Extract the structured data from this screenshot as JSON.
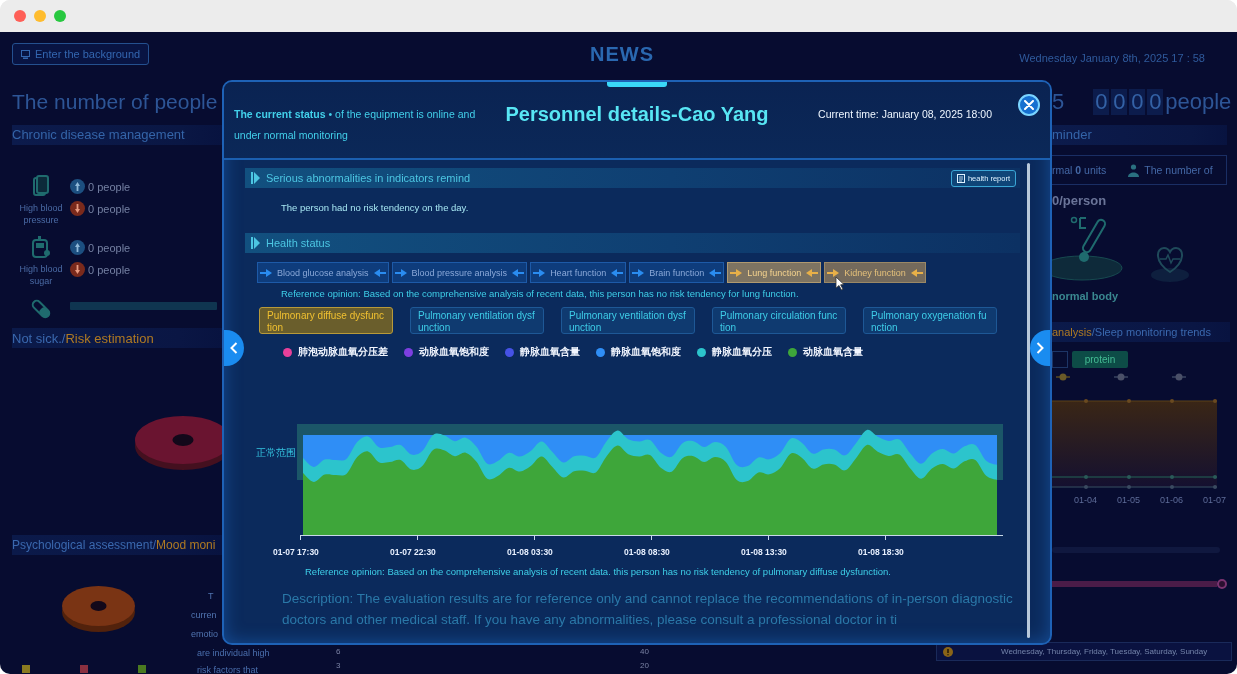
{
  "topbar": {
    "back_button": "Enter the background",
    "title": "NEWS",
    "datetime": "Wednesday January 8th, 2025 17 : 58"
  },
  "left_panel": {
    "headline": "The number of people",
    "section_title": "Chronic disease management",
    "indicators": [
      {
        "kind": "pressure",
        "label": "High blood pressure",
        "counts": [
          {
            "kind": "high",
            "text": "0 people"
          },
          {
            "kind": "low",
            "text": "0 people"
          }
        ]
      },
      {
        "kind": "sugar",
        "label": "High blood sugar",
        "counts": [
          {
            "kind": "high",
            "text": "0 people"
          },
          {
            "kind": "low",
            "text": "0 people"
          }
        ]
      }
    ],
    "risk_tabs": {
      "separator": "/",
      "tabs": [
        {
          "label": "Not sick.",
          "selected": false
        },
        {
          "label": "Risk estimation",
          "selected": true
        }
      ]
    },
    "mood_tabs": {
      "separator": "/",
      "tabs": [
        {
          "label": "Psychological assessment",
          "selected": false
        },
        {
          "label": "Mood moni",
          "selected": true
        }
      ]
    },
    "panel_heading": "T",
    "panel_lines": [
      "curren",
      "emotio"
    ]
  },
  "right_panel": {
    "partial_count": "5",
    "digits": [
      "0",
      "0",
      "0",
      "0"
    ],
    "unit": "people",
    "section_title": "minder",
    "stat_abnormal": "rmal **0** units",
    "stat_people": "The number of",
    "per_person": "**0**/person",
    "body_status": "normal body",
    "trend_tabs": {
      "separator": "/",
      "tabs": [
        {
          "label": "analysis",
          "selected": true
        },
        {
          "label": "Sleep monitoring trends",
          "selected": false
        }
      ]
    },
    "filter_button": "protein",
    "x_labels": [
      "01-04",
      "01-05",
      "01-06",
      "01-07"
    ]
  },
  "bottom_strip": {
    "panel_lines": [
      "are individual high",
      "risk factors that"
    ],
    "axis_a": [
      "6",
      "3"
    ],
    "axis_b": [
      "40",
      "20"
    ],
    "weekdays": "Wednesday, Thursday, Friday, Tuesday, Saturday, Sunday"
  },
  "modal": {
    "status": "**The current status** • of the equipment is online and under normal monitoring",
    "title": "Personnel details-Cao Yang",
    "time": "Current time: January 08, 2025 18:00",
    "alerts": {
      "title": "Serious abnormalities in indicators remind",
      "report_button": "health report",
      "message": "The person had no risk tendency on the day."
    },
    "health": {
      "title": "Health status",
      "tabs": [
        {
          "label": "Blood glucose analysis",
          "selected": false,
          "hovered": false
        },
        {
          "label": "Blood pressure analysis",
          "selected": false,
          "hovered": false
        },
        {
          "label": "Heart function",
          "selected": false,
          "hovered": false
        },
        {
          "label": "Brain function",
          "selected": false,
          "hovered": false
        },
        {
          "label": "Lung function",
          "selected": true,
          "hovered": false
        },
        {
          "label": "Kidney function",
          "selected": false,
          "hovered": true
        }
      ],
      "opinion": "Reference opinion: Based on the comprehensive analysis of recent data, this person has no risk tendency for lung function.",
      "subtabs": [
        {
          "label": "Pulmonary diffuse dysfunction",
          "selected": true
        },
        {
          "label": "Pulmonary ventilation dysfunction",
          "selected": false
        },
        {
          "label": "Pulmonary ventilation dysfunction",
          "selected": false
        },
        {
          "label": "Pulmonary circulation function",
          "selected": false
        },
        {
          "label": "Pulmonary oxygenation function",
          "selected": false
        }
      ],
      "legend": [
        {
          "label": "肺泡动脉血氧分压差",
          "color": "#e8409a"
        },
        {
          "label": "动脉血氧饱和度",
          "color": "#7d3fe0"
        },
        {
          "label": "静脉血氧含量",
          "color": "#4652e6"
        },
        {
          "label": "静脉血氧饱和度",
          "color": "#2f8ef6"
        },
        {
          "label": "静脉血氧分压",
          "color": "#2cc4cc"
        },
        {
          "label": "动脉血氧含量",
          "color": "#3ea63a"
        }
      ],
      "chart": {
        "band_label": "正常范围",
        "x_labels": [
          "01-07 17:30",
          "01-07 22:30",
          "01-08 03:30",
          "01-08 08:30",
          "01-08 13:30",
          "01-08 18:30"
        ]
      },
      "chart_opinion": "Reference opinion: Based on the comprehensive analysis of recent data. this person has no risk tendency of pulmonary diffuse dysfunction.",
      "description": "Description: The evaluation results are for reference only and cannot replace the recommendations of in-person diagnostic doctors and other medical staff. If you have any abnormalities, please consult a professional doctor in ti"
    }
  }
}
